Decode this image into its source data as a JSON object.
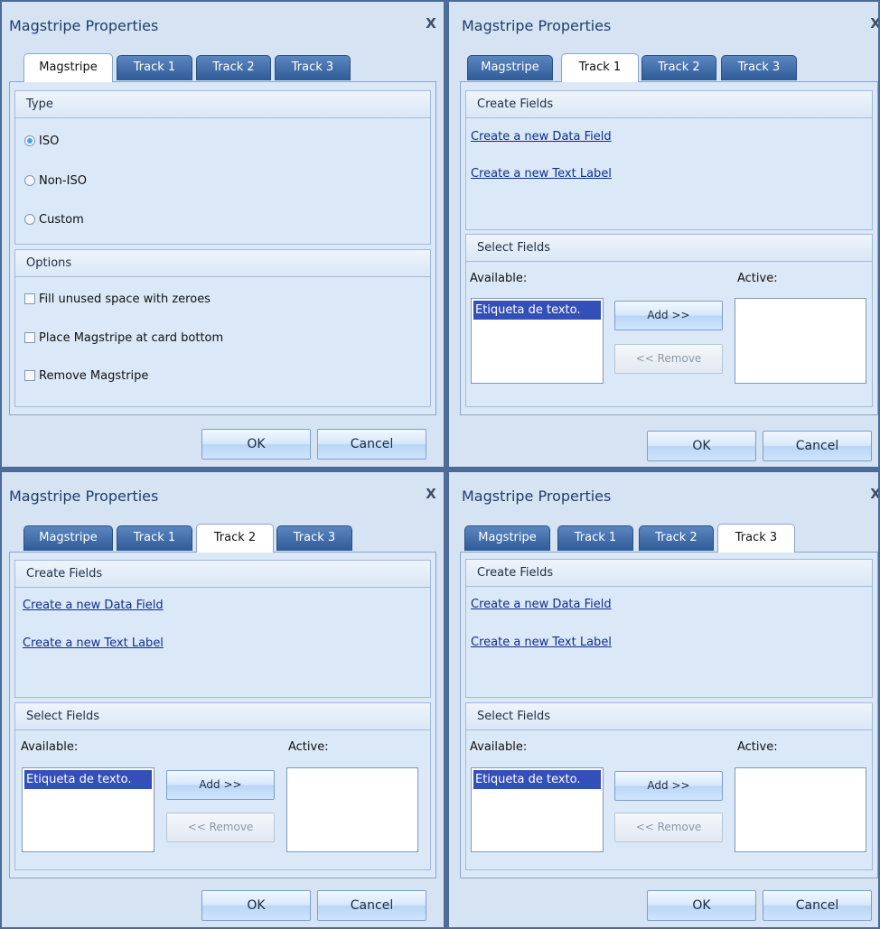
{
  "dialog": {
    "title": "Magstripe Properties",
    "close_glyph": "X",
    "tabs": [
      "Magstripe",
      "Track 1",
      "Track 2",
      "Track 3"
    ],
    "ok_label": "OK",
    "cancel_label": "Cancel"
  },
  "magstripe_tab": {
    "type_header": "Type",
    "type_options": [
      "ISO",
      "Non-ISO",
      "Custom"
    ],
    "selected_type": "ISO",
    "options_header": "Options",
    "options": [
      "Fill unused space with zeroes",
      "Place Magstripe at card bottom",
      "Remove Magstripe"
    ]
  },
  "track_tab": {
    "create_header": "Create Fields",
    "create_data_field_link": "Create a new Data Field",
    "create_text_label_link": "Create a new Text Label",
    "select_header": "Select Fields",
    "available_label": "Available:",
    "active_label": "Active:",
    "available_items": [
      "Etiqueta de texto."
    ],
    "add_label": "Add >>",
    "remove_label": "<< Remove"
  },
  "panels": [
    {
      "active_tab": "Magstripe"
    },
    {
      "active_tab": "Track 1"
    },
    {
      "active_tab": "Track 2"
    },
    {
      "active_tab": "Track 3"
    }
  ],
  "colors": {
    "accent_tab": "#3a66a6",
    "selection": "#334fb8",
    "link": "#0f2f88",
    "panel_bg": "#d5e3f3"
  }
}
